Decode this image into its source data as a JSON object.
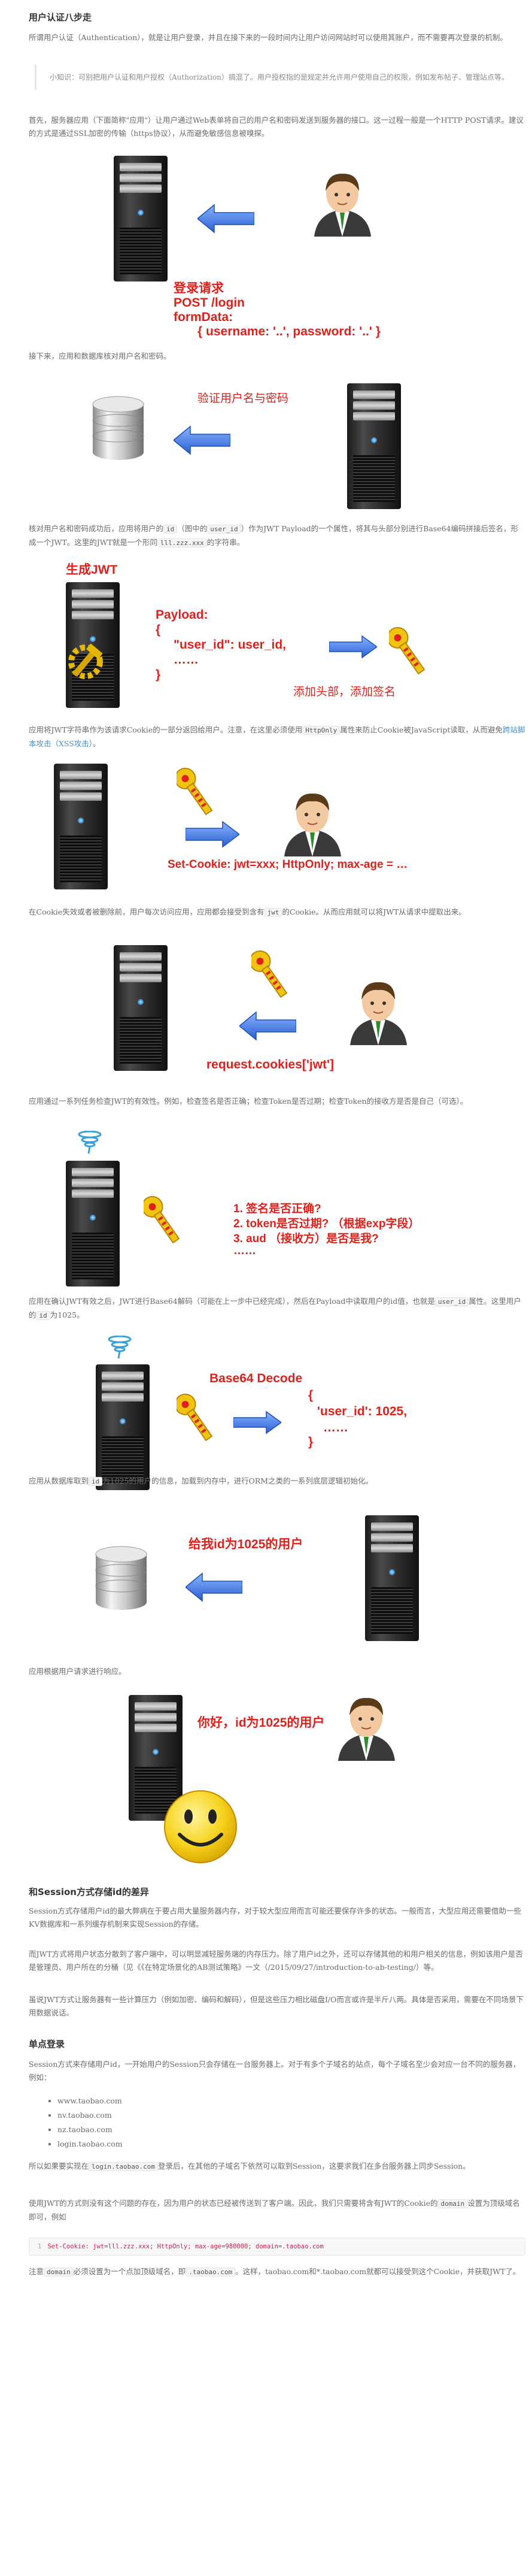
{
  "section1": {
    "title": "用户认证八步走",
    "intro": "所谓用户认证（Authentication），就是让用户登录，并且在接下来的一段时间内让用户访问网站时可以使用其账户，而不需要再次登录的机制。",
    "tip": "小知识：可别把用户认证和用户授权（Authorization）搞混了。用户授权指的是规定并允许用户使用自己的权限，例如发布帖子、管理站点等。"
  },
  "step1": {
    "text": "首先，服务器应用（下面简称\"应用\"）让用户通过Web表单将自己的用户名和密码发送到服务器的接口。这一过程一般是一个HTTP POST请求。建议的方式是通过SSL加密的传输（https协议），从而避免敏感信息被嗅探。",
    "label_title": "登录请求",
    "label_method": "POST /login",
    "label_form": "formData:",
    "label_body": "{ username: '..', password: '..' }"
  },
  "step2": {
    "text": "接下来，应用和数据库核对用户名和密码。",
    "label": "验证用户名与密码"
  },
  "step3": {
    "text_a": "核对用户名和密码成功后，应用将用户的",
    "code_id": "id",
    "text_b": "（图中的",
    "code_user_id": "user_id",
    "text_c": "）作为JWT Payload的一个属性，将其与头部分别进行Base64编码拼接后签名，形成一个JWT。这里的JWT就是一个形同",
    "code_sample": "lll.zzz.xxx",
    "text_d": "的字符串。",
    "label_gen": "生成JWT",
    "label_payload": "Payload:",
    "label_brace_open": "{",
    "label_user_id": "\"user_id\":  user_id,",
    "label_dots": "……",
    "label_brace_close": "}",
    "label_sign": "添加头部，添加签名"
  },
  "step4": {
    "text_a": "应用将JWT字符串作为该请求Cookie的一部分返回给用户。注意，在这里必须使用",
    "code_httponly": "HttpOnly",
    "text_b": "属性来防止Cookie被JavaScript读取，从而避免",
    "link": "跨站脚本攻击（XSS攻击）",
    "text_c": "。",
    "label": "Set-Cookie: jwt=xxx; HttpOnly; max-age = …"
  },
  "step5": {
    "text_a": "在Cookie失效或者被删除前，用户每次访问应用，应用都会接受到含有",
    "code_jwt": "jwt",
    "text_b": "的Cookie。从而应用就可以将JWT从请求中提取出来。",
    "label": "request.cookies['jwt']"
  },
  "step6": {
    "text": "应用通过一系列任务检查JWT的有效性。例如，检查签名是否正确；检查Token是否过期；检查Token的接收方是否是自己（可选）。",
    "label_1": "1. 签名是否正确?",
    "label_2": "2. token是否过期? （根据exp字段）",
    "label_3": "3. aud （接收方）是否是我?",
    "label_4": "……"
  },
  "step7": {
    "text_a": "应用在确认JWT有效之后，JWT进行Base64解码（可能在上一步中已经完成），然后在Payload中读取用户的id值，也就是",
    "code_user_id": "user_id",
    "text_b": "属性。这里用户的",
    "code_id": "id",
    "text_c": "为1025。",
    "label_title": "Base64 Decode",
    "label_brace_open": "{",
    "label_user_id": "'user_id': 1025,",
    "label_dots": "……",
    "label_brace_close": "}"
  },
  "step8": {
    "text_a": "应用从数据库取到",
    "code_id": "id",
    "text_b": "为1025的用户的信息，加载到内存中，进行ORM之类的一系列底层逻辑初始化。",
    "label": "给我id为1025的用户"
  },
  "step9": {
    "text": "应用根据用户请求进行响应。",
    "label": "你好，id为1025的用户"
  },
  "section2": {
    "title": "和Session方式存储id的差异",
    "p1": "Session方式存储用户id的最大弊病在于要占用大量服务器内存，对于较大型应用而言可能还要保存许多的状态。一般而言，大型应用还需要借助一些KV数据库和一系列缓存机制来实现Session的存储。",
    "p2": "而JWT方式将用户状态分散到了客户端中，可以明显减轻服务端的内存压力。除了用户id之外，还可以存储其他的和用户相关的信息，例如该用户是否是管理员、用户所在的分桶（见《《在特定场景化的AB测试策略》一文（/2015/09/27/introduction-to-ab-testing/）等。",
    "p3": "虽说JWT方式让服务器有一些计算压力（例如加密、编码和解码），但是这些压力相比磁盘I/O而言或许是半斤八两。具体是否采用，需要在不同场景下用数据说话。"
  },
  "section3": {
    "title": "单点登录",
    "p1": "Session方式来存储用户id，一开始用户的Session只会存储在一台服务器上。对于有多个子域名的站点，每个子域名至少会对应一台不同的服务器，例如：",
    "domains": [
      "www.taobao.com",
      "nv.taobao.com",
      "nz.taobao.com",
      "login.taobao.com"
    ],
    "p2_a": "所以如果要实现在",
    "p2_code": "login.taobao.com",
    "p2_b": "登录后，在其他的子域名下依然可以取到Session，这要求我们在多台服务器上同步Session。",
    "p3_a": "使用JWT的方式则没有这个问题的存在，因为用户的状态已经被传送到了客户端。因此，我们只需要将含有JWT的Cookie的",
    "p3_code": "domain",
    "p3_b": "设置为顶级域名即可，例如",
    "code_line_num": "1",
    "code_line": "Set-Cookie: jwt=lll.zzz.xxx; HttpOnly; max-age=980000; domain=.taobao.com",
    "p4_a": "注意",
    "p4_code1": "domain",
    "p4_b": "必须设置为一个点加顶级域名，即",
    "p4_code2": ".taobao.com",
    "p4_c": "。这样，taobao.com和*.taobao.com就都可以接受到这个Cookie，并获取JWT了。"
  },
  "colors": {
    "accent_red": "#e0201b",
    "arrow_blue": "#4a7fe0",
    "link_blue": "#4a90c2",
    "key_yellow": "#f1c40f"
  }
}
